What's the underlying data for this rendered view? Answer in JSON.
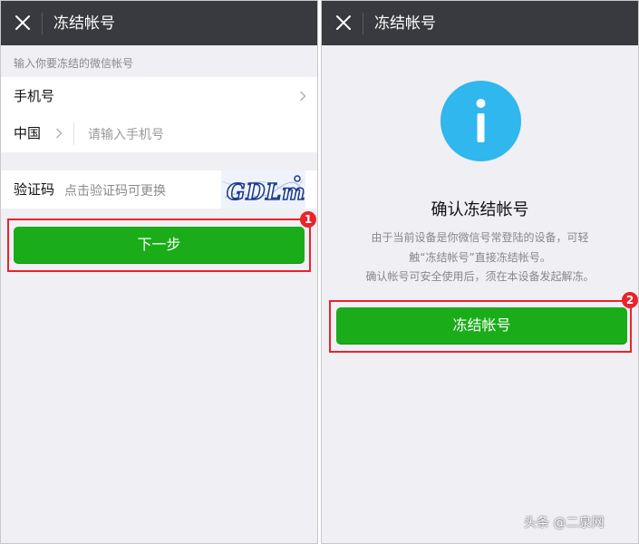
{
  "colors": {
    "titlebar_bg": "#393a3f",
    "page_bg": "#efeff4",
    "primary_button": "#1aad19",
    "highlight": "#e8242a",
    "info_icon": "#2fb7ee"
  },
  "left": {
    "title": "冻结帐号",
    "close_icon": "close-icon",
    "hint": "输入你要冻结的微信帐号",
    "phone_row_label": "手机号",
    "country_label": "中国",
    "phone_placeholder": "请输入手机号",
    "captcha_label": "验证码",
    "captcha_placeholder": "点击验证码可更换",
    "captcha_text": "GDLm",
    "next_button": "下一步",
    "step_badge": "1"
  },
  "right": {
    "title": "冻结帐号",
    "close_icon": "close-icon",
    "info_icon": "info-icon",
    "confirm_title": "确认冻结帐号",
    "desc_line1": "由于当前设备是你微信号常登陆的设备，可轻",
    "desc_line2": "触“冻结帐号”直接冻结帐号。",
    "desc_line3": "确认帐号可安全使用后，须在本设备发起解冻。",
    "freeze_button": "冻结帐号",
    "step_badge": "2"
  },
  "watermark": "头条 @二泉网"
}
